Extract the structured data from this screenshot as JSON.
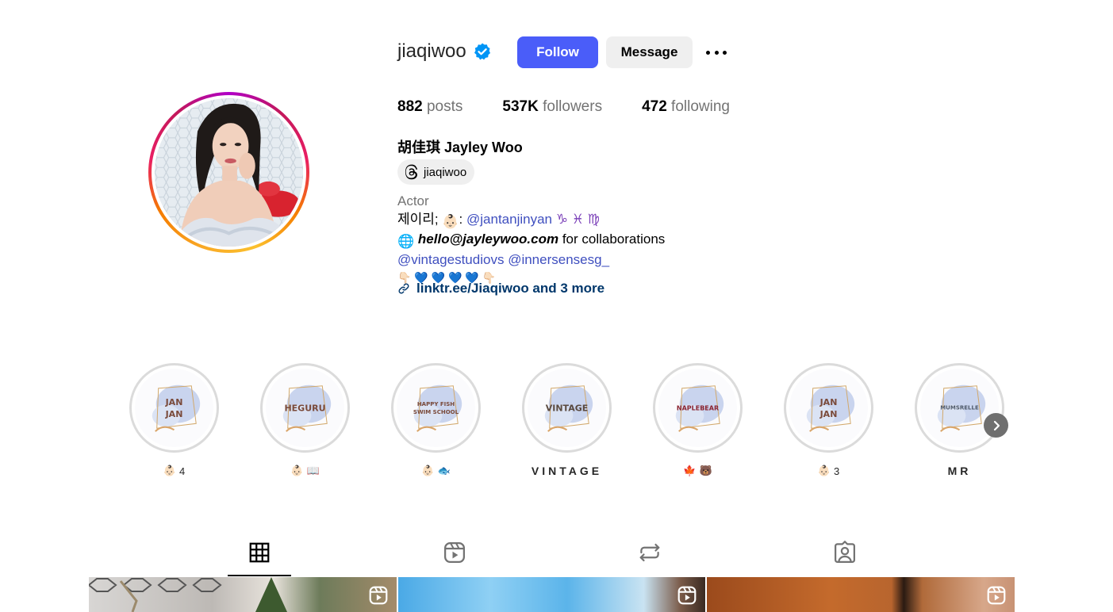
{
  "profile": {
    "username": "jiaqiwoo",
    "verified": true,
    "follow_label": "Follow",
    "message_label": "Message",
    "stats": {
      "posts_count": "882",
      "posts_label": " posts",
      "followers_count": "537K",
      "followers_label": " followers",
      "following_count": "472",
      "following_label": " following"
    },
    "full_name": "胡佳琪 Jayley Woo",
    "threads_handle": "jiaqiwoo",
    "bio": {
      "category": "Actor",
      "line1_prefix": "제이리; ",
      "line1_colon": ": ",
      "line1_mention": "@jantanjinyan",
      "line1_signs": "♑ ♓ ♍",
      "line2_email": "hello@jayleywoo.com",
      "line2_suffix": " for collaborations",
      "line3_mention1": "@vintagestudiovs",
      "line3_mention2": "@innersensesg_",
      "line4_emojis": "👇🏻 💙 💙 💙 💙 👇🏻"
    },
    "website": "linktr.ee/Jiaqiwoo and 3 more"
  },
  "highlights": [
    {
      "cover_text": "JAN\nJAN",
      "label": "4",
      "label_emoji": "👶🏻"
    },
    {
      "cover_text": "HEGURU",
      "label": "📖",
      "label_emoji": "👶🏻"
    },
    {
      "cover_text": "HAPPY FISH\nSWIM SCHOOL",
      "label": "🐟",
      "label_emoji": "👶🏻"
    },
    {
      "cover_text": "VINTAGE",
      "label": "VINTAGE",
      "label_emoji": ""
    },
    {
      "cover_text": "NAPLEBEAR",
      "label": "🐻",
      "label_emoji": "🍁"
    },
    {
      "cover_text": "JAN\nJAN",
      "label": "3",
      "label_emoji": "👶🏻"
    },
    {
      "cover_text": "MUMSRELLE",
      "label": "MR",
      "label_emoji": ""
    }
  ],
  "tabs": [
    {
      "name": "posts",
      "icon": "grid-icon",
      "active": true
    },
    {
      "name": "reels",
      "icon": "reels-icon",
      "active": false
    },
    {
      "name": "reposts",
      "icon": "repost-icon",
      "active": false
    },
    {
      "name": "tagged",
      "icon": "tagged-icon",
      "active": false
    }
  ],
  "colors": {
    "follow_button": "#4a5df9",
    "link": "#3f4fbf",
    "website": "#00376b",
    "verified": "#0095f6"
  }
}
